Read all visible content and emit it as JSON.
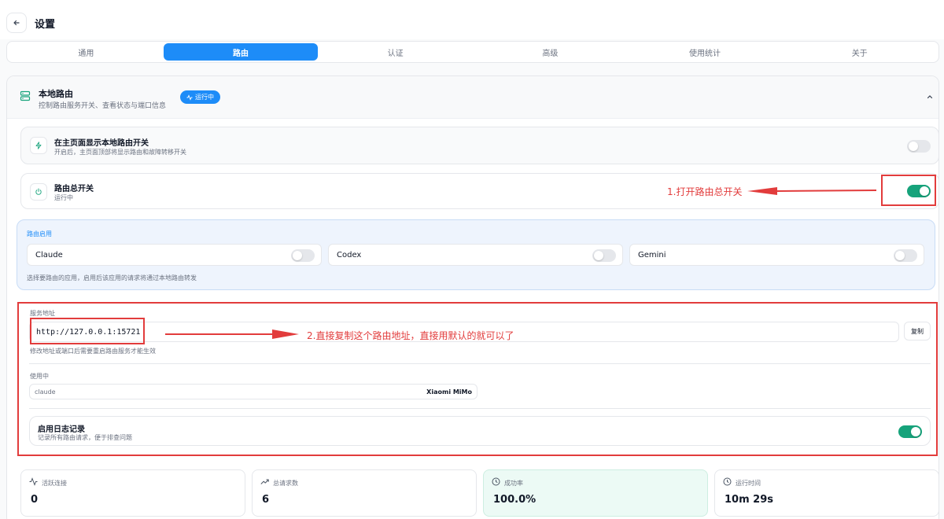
{
  "header": {
    "title": "设置"
  },
  "tabs": [
    {
      "label": "通用",
      "active": false
    },
    {
      "label": "路由",
      "active": true
    },
    {
      "label": "认证",
      "active": false
    },
    {
      "label": "高级",
      "active": false
    },
    {
      "label": "使用统计",
      "active": false
    },
    {
      "label": "关于",
      "active": false
    }
  ],
  "panel": {
    "title": "本地路由",
    "subtitle": "控制路由服务开关、查看状态与端口信息",
    "badge": "运行中"
  },
  "show_switch": {
    "title": "在主页面显示本地路由开关",
    "subtitle": "开启后，主页面顶部将显示路由和故障转移开关",
    "enabled": false
  },
  "master_switch": {
    "title": "路由总开关",
    "subtitle": "运行中",
    "enabled": true
  },
  "apps": {
    "label": "路由启用",
    "items": [
      {
        "name": "Claude",
        "enabled": false
      },
      {
        "name": "Codex",
        "enabled": false
      },
      {
        "name": "Gemini",
        "enabled": false
      }
    ],
    "hint": "选择要路由的应用，启用后该应用的请求将通过本地路由转发"
  },
  "service": {
    "label": "服务地址",
    "address": "http://127.0.0.1:15721",
    "copy_label": "复制",
    "hint": "修改地址或端口后需要重启路由服务才能生效"
  },
  "in_use": {
    "label": "使用中",
    "app": "claude",
    "provider": "Xiaomi MiMo"
  },
  "logging": {
    "title": "启用日志记录",
    "subtitle": "记录所有路由请求，便于排查问题",
    "enabled": true
  },
  "stats": [
    {
      "label": "活跃连接",
      "value": "0",
      "icon": "activity-icon"
    },
    {
      "label": "总请求数",
      "value": "6",
      "icon": "trending-up-icon"
    },
    {
      "label": "成功率",
      "value": "100.0%",
      "icon": "clock-icon"
    },
    {
      "label": "运行时间",
      "value": "10m 29s",
      "icon": "clock-icon"
    }
  ],
  "annotations": {
    "step1": "1.打开路由总开关",
    "step2": "2.直接复制这个路由地址，直接用默认的就可以了"
  },
  "colors": {
    "accent": "#1d8cf8",
    "toggle_on": "#16a37b",
    "annotation": "#e23c3c"
  }
}
